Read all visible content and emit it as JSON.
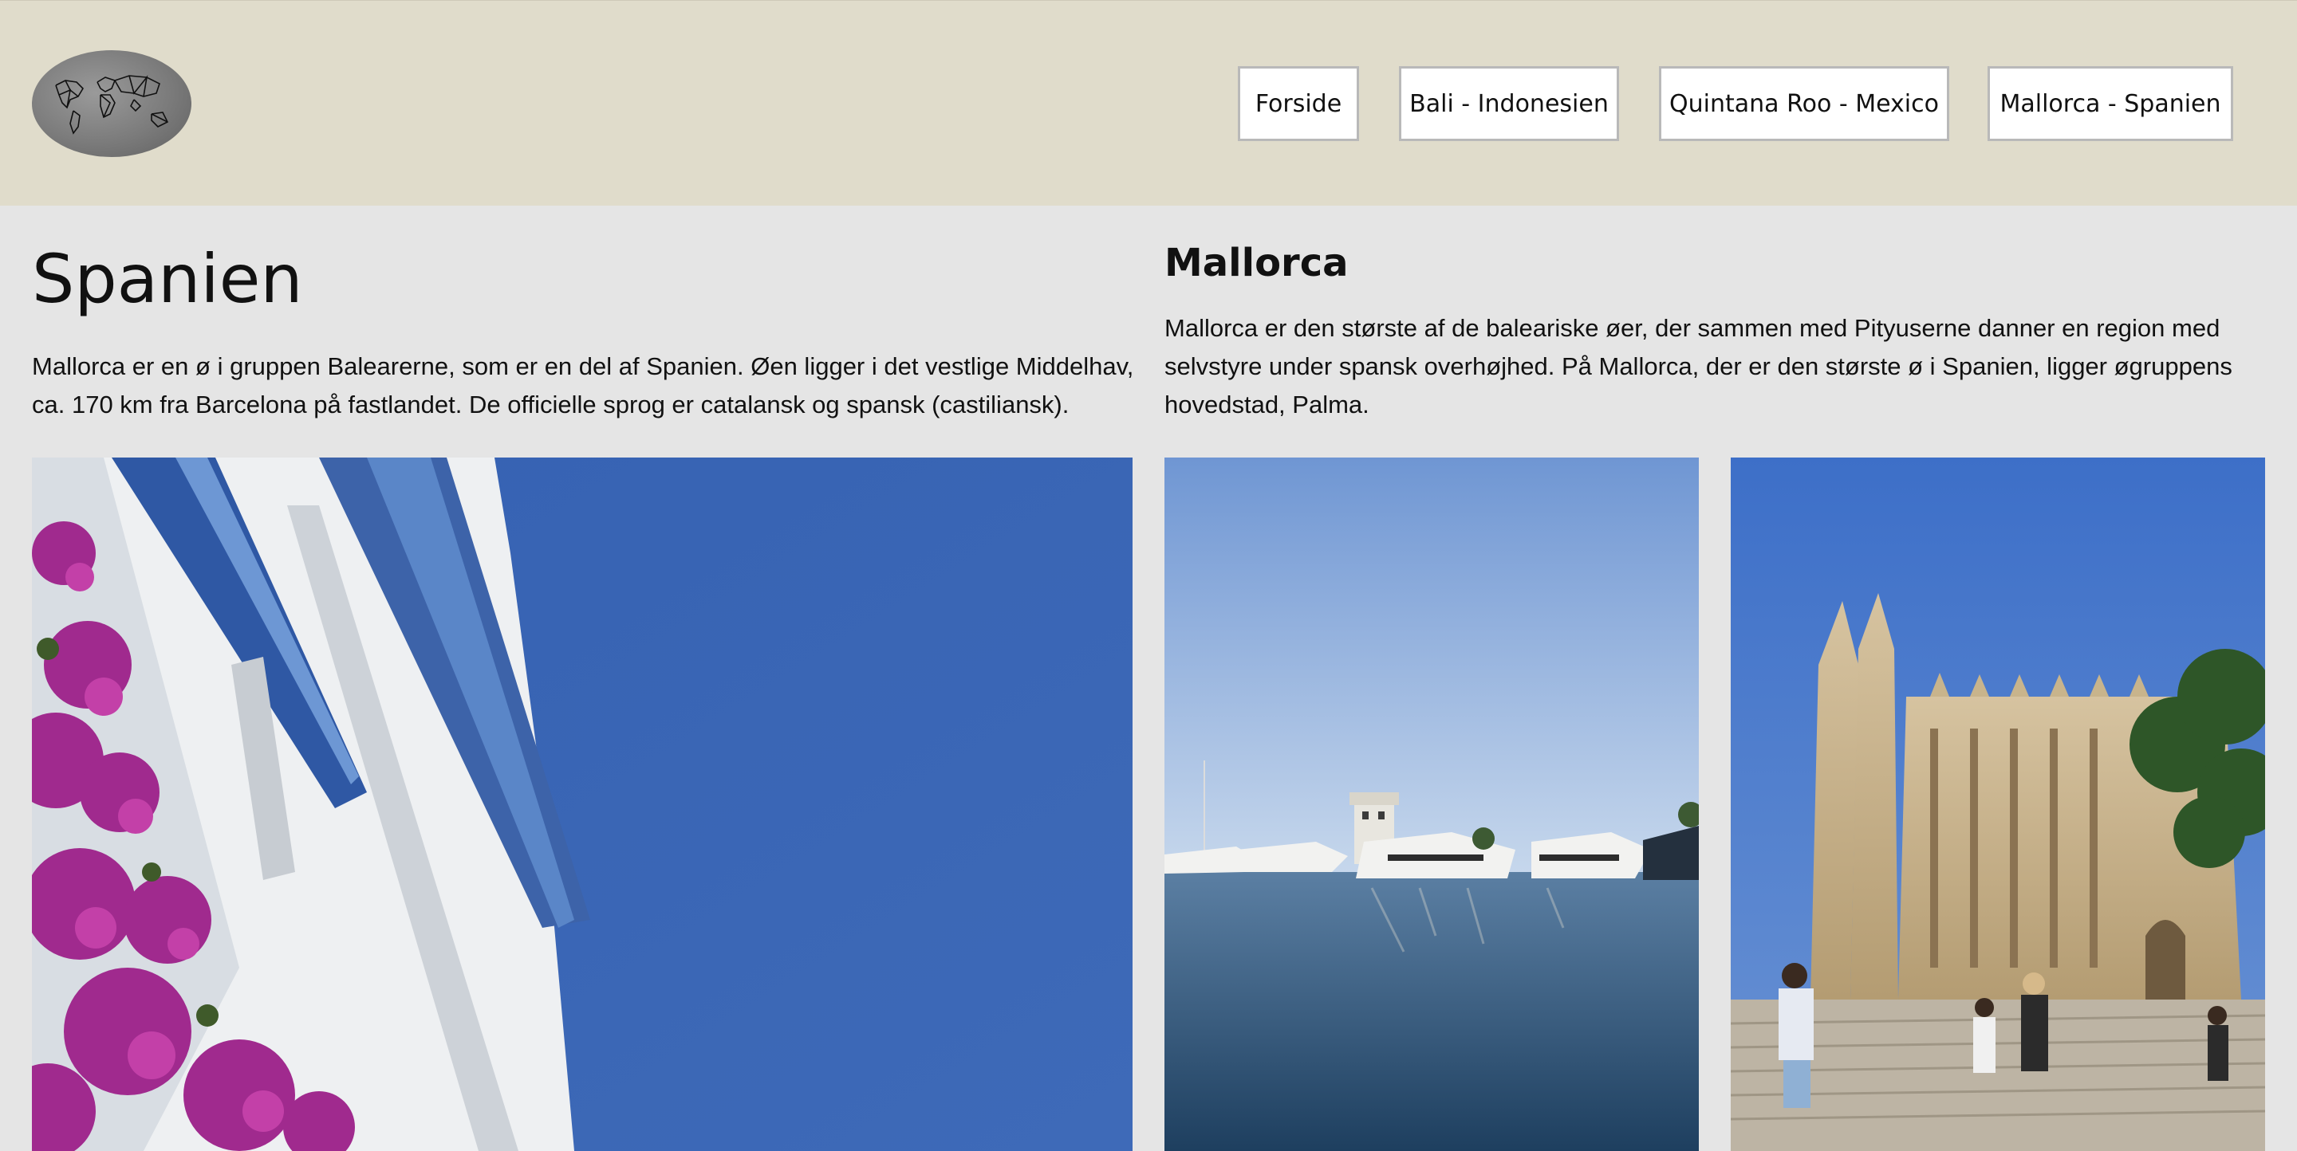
{
  "header": {
    "logo_alt": "world-map-logo",
    "nav": [
      {
        "label": "Forside"
      },
      {
        "label": "Bali - Indonesien"
      },
      {
        "label": "Quintana Roo - Mexico"
      },
      {
        "label": "Mallorca - Spanien"
      }
    ]
  },
  "left": {
    "title": "Spanien",
    "text": "Mallorca er en ø i gruppen Balearerne, som er en del af Spanien. Øen ligger i det vestlige Middelhav, ca. 170 km fra Barcelona på fastlandet. De officielle sprog er catalansk og spansk (castiliansk)."
  },
  "right": {
    "title": "Mallorca",
    "text": "Mallorca er den største af de baleariske øer, der sammen med Pityuserne danner en region med selvstyre under spansk overhøjhed. På Mallorca, der er den største ø i Spanien, ligger øgruppens hovedstad, Palma."
  },
  "colors": {
    "header_bg": "#e0dccb",
    "page_bg": "#e5e5e5",
    "sky_blue": "#3c67b6"
  }
}
